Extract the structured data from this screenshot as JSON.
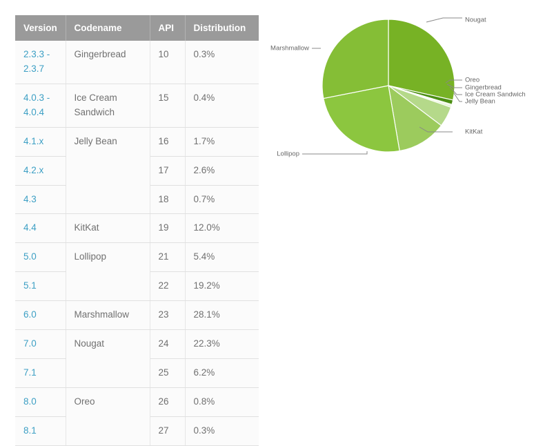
{
  "table": {
    "columns": [
      "Version",
      "Codename",
      "API",
      "Distribution"
    ],
    "rows": [
      {
        "version": "2.3.3 - 2.3.7",
        "codename": "Gingerbread",
        "api": "10",
        "distribution": "0.3%",
        "codename_new": true
      },
      {
        "version": "4.0.3 - 4.0.4",
        "codename": "Ice Cream Sandwich",
        "api": "15",
        "distribution": "0.4%",
        "codename_new": true
      },
      {
        "version": "4.1.x",
        "codename": "Jelly Bean",
        "api": "16",
        "distribution": "1.7%",
        "codename_new": true
      },
      {
        "version": "4.2.x",
        "codename": "",
        "api": "17",
        "distribution": "2.6%",
        "codename_new": false
      },
      {
        "version": "4.3",
        "codename": "",
        "api": "18",
        "distribution": "0.7%",
        "codename_new": false
      },
      {
        "version": "4.4",
        "codename": "KitKat",
        "api": "19",
        "distribution": "12.0%",
        "codename_new": true
      },
      {
        "version": "5.0",
        "codename": "Lollipop",
        "api": "21",
        "distribution": "5.4%",
        "codename_new": true
      },
      {
        "version": "5.1",
        "codename": "",
        "api": "22",
        "distribution": "19.2%",
        "codename_new": false
      },
      {
        "version": "6.0",
        "codename": "Marshmallow",
        "api": "23",
        "distribution": "28.1%",
        "codename_new": true
      },
      {
        "version": "7.0",
        "codename": "Nougat",
        "api": "24",
        "distribution": "22.3%",
        "codename_new": true
      },
      {
        "version": "7.1",
        "codename": "",
        "api": "25",
        "distribution": "6.2%",
        "codename_new": false
      },
      {
        "version": "8.0",
        "codename": "Oreo",
        "api": "26",
        "distribution": "0.8%",
        "codename_new": true
      },
      {
        "version": "8.1",
        "codename": "",
        "api": "27",
        "distribution": "0.3%",
        "codename_new": false
      }
    ]
  },
  "chart_data": {
    "type": "pie",
    "title": "",
    "legend_position": "callout-labels",
    "labels": [
      "Nougat",
      "Oreo",
      "Gingerbread",
      "Ice Cream Sandwich",
      "Jelly Bean",
      "KitKat",
      "Lollipop",
      "Marshmallow"
    ],
    "values": [
      28.5,
      1.1,
      0.3,
      0.4,
      5.0,
      12.0,
      24.6,
      28.1
    ],
    "colors": [
      "#77b225",
      "#4c8f13",
      "#cfe6ac",
      "#d8ecbb",
      "#b5d98a",
      "#9ccb5d",
      "#8cc63f",
      "#85be36"
    ],
    "slices": [
      {
        "label": "Nougat",
        "value": 28.5,
        "color": "#77b225"
      },
      {
        "label": "Oreo",
        "value": 1.1,
        "color": "#4c8f13"
      },
      {
        "label": "Gingerbread",
        "value": 0.3,
        "color": "#cfe6ac"
      },
      {
        "label": "Ice Cream Sandwich",
        "value": 0.4,
        "color": "#d8ecbb"
      },
      {
        "label": "Jelly Bean",
        "value": 5.0,
        "color": "#b5d98a"
      },
      {
        "label": "KitKat",
        "value": 12.0,
        "color": "#9ccb5d"
      },
      {
        "label": "Lollipop",
        "value": 24.6,
        "color": "#8cc63f"
      },
      {
        "label": "Marshmallow",
        "value": 28.1,
        "color": "#85be36"
      }
    ],
    "callouts": {
      "nougat": "Nougat",
      "oreo": "Oreo",
      "gingerbread": "Gingerbread",
      "ice_cream_sandwich": "Ice Cream Sandwich",
      "jelly_bean": "Jelly Bean",
      "kitkat": "KitKat",
      "lollipop": "Lollipop",
      "marshmallow": "Marshmallow"
    }
  }
}
